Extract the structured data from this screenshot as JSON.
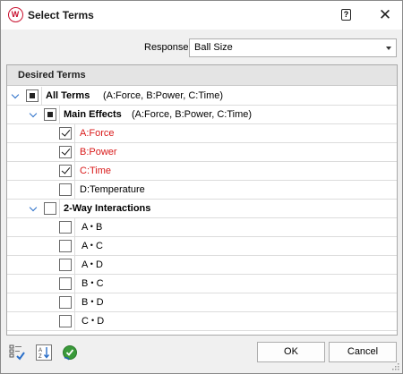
{
  "window": {
    "title": "Select Terms",
    "help_icon": "help-icon",
    "close_icon": "close-icon"
  },
  "response": {
    "label": "Response",
    "value": "Ball Size"
  },
  "panel": {
    "header": "Desired Terms"
  },
  "tree": {
    "all_terms": {
      "label": "All Terms",
      "detail": "(A:Force, B:Power, C:Time)",
      "state": "indeterminate"
    },
    "main_effects": {
      "label": "Main Effects",
      "detail": "(A:Force, B:Power, C:Time)",
      "state": "indeterminate"
    },
    "main_items": [
      {
        "label": "A:Force",
        "checked": true,
        "highlight": true
      },
      {
        "label": "B:Power",
        "checked": true,
        "highlight": true
      },
      {
        "label": "C:Time",
        "checked": true,
        "highlight": true
      },
      {
        "label": "D:Temperature",
        "checked": false,
        "highlight": false
      }
    ],
    "two_way": {
      "label": "2-Way Interactions",
      "state": "unchecked"
    },
    "two_way_items": [
      {
        "left": "A",
        "right": "B"
      },
      {
        "left": "A",
        "right": "C"
      },
      {
        "left": "A",
        "right": "D"
      },
      {
        "left": "B",
        "right": "C"
      },
      {
        "left": "B",
        "right": "D"
      },
      {
        "left": "C",
        "right": "D"
      }
    ],
    "bullet": "•"
  },
  "footer": {
    "ok_label": "OK",
    "cancel_label": "Cancel",
    "tools": [
      "select-all-icon",
      "sort-terms-icon",
      "reset-icon"
    ]
  },
  "colors": {
    "accent": "#2a6fc9",
    "highlight_text": "#d91a1a",
    "brand": "#c8102e"
  }
}
